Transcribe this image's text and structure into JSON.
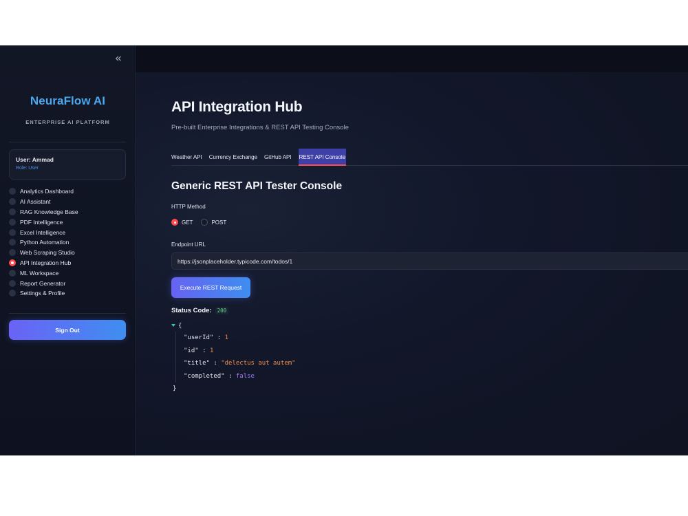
{
  "sidebar": {
    "collapse_icon": "double-chevron-left-icon",
    "brand": "NeuraFlow AI",
    "brand_sub": "ENTERPRISE AI PLATFORM",
    "user": {
      "name": "User: Ammad",
      "role": "Role: User"
    },
    "nav_items": [
      {
        "label": "Analytics Dashboard",
        "active": false
      },
      {
        "label": "AI Assistant",
        "active": false
      },
      {
        "label": "RAG Knowledge Base",
        "active": false
      },
      {
        "label": "PDF Intelligence",
        "active": false
      },
      {
        "label": "Excel Intelligence",
        "active": false
      },
      {
        "label": "Python Automation",
        "active": false
      },
      {
        "label": "Web Scraping Studio",
        "active": false
      },
      {
        "label": "API Integration Hub",
        "active": true
      },
      {
        "label": "ML Workspace",
        "active": false
      },
      {
        "label": "Report Generator",
        "active": false
      },
      {
        "label": "Settings & Profile",
        "active": false
      }
    ],
    "sign_out_label": "Sign Out"
  },
  "main": {
    "title": "API Integration Hub",
    "subtitle": "Pre-built Enterprise Integrations & REST API Testing Console",
    "tabs": [
      {
        "label": "Weather API",
        "active": false
      },
      {
        "label": "Currency Exchange",
        "active": false
      },
      {
        "label": "GitHub API",
        "active": false
      },
      {
        "label": "REST API Console",
        "active": true
      }
    ],
    "section_title": "Generic REST API Tester Console",
    "http_method": {
      "label": "HTTP Method",
      "options": [
        "GET",
        "POST"
      ],
      "selected": "GET"
    },
    "endpoint": {
      "label": "Endpoint URL",
      "value": "https://jsonplaceholder.typicode.com/todos/1"
    },
    "execute_label": "Execute REST Request",
    "status": {
      "label": "Status Code:",
      "code": "200"
    },
    "response": {
      "open_brace": "{",
      "close_brace": "}",
      "fields": [
        {
          "key": "\"userId\"",
          "value": "1",
          "type": "number"
        },
        {
          "key": "\"id\"",
          "value": "1",
          "type": "number"
        },
        {
          "key": "\"title\"",
          "value": "\"delectus aut autem\"",
          "type": "string"
        },
        {
          "key": "\"completed\"",
          "value": "false",
          "type": "boolean"
        }
      ]
    }
  },
  "colors": {
    "accent": "#ff4b4b",
    "brand": "#4aa8f0",
    "button_gradient_start": "#6762f2",
    "button_gradient_end": "#3e8ef0",
    "status_ok": "#5fd38d"
  }
}
